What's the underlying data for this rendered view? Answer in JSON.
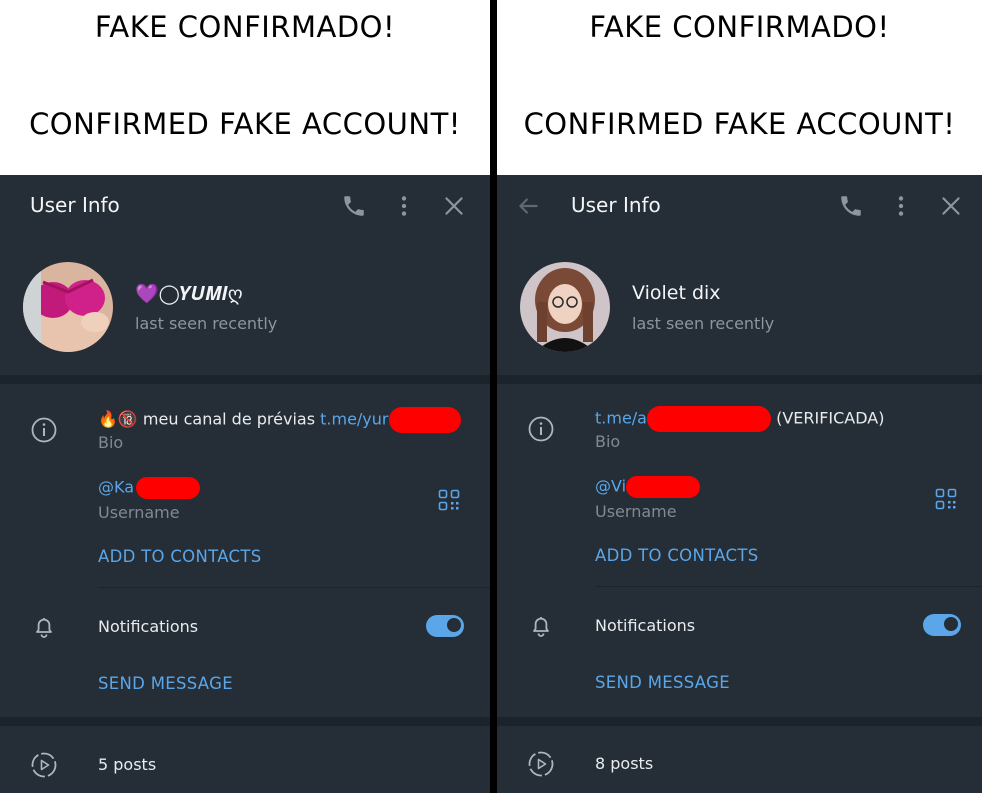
{
  "panels": [
    {
      "banner": {
        "line1": "FAKE CONFIRMADO!",
        "line2": "CONFIRMED FAKE ACCOUNT!"
      },
      "header": {
        "title": "User Info",
        "icons": [
          "phone-icon",
          "more-vertical-icon",
          "close-icon"
        ]
      },
      "profile": {
        "name": "💜◯𝒀𝑼𝑴𝑰ღ",
        "status": "last seen recently"
      },
      "bio": {
        "prefix": "🔥🔞 meu canal de prévias ",
        "link": "t.me/yur",
        "label": "Bio"
      },
      "username": {
        "value": "@Ka",
        "label": "Username"
      },
      "add_contacts": "ADD TO CONTACTS",
      "notifications": {
        "label": "Notifications",
        "enabled": true
      },
      "send_message": "SEND MESSAGE",
      "posts": "5 posts"
    },
    {
      "banner": {
        "line1": "FAKE CONFIRMADO!",
        "line2": "CONFIRMED FAKE ACCOUNT!"
      },
      "header": {
        "title": "User Info",
        "icons": [
          "back-arrow-icon",
          "phone-icon",
          "more-vertical-icon",
          "close-icon"
        ]
      },
      "profile": {
        "name": "Violet dix",
        "status": "last seen recently"
      },
      "bio": {
        "link": "t.me/a",
        "suffix": " (VERIFICADA)",
        "label": "Bio"
      },
      "username": {
        "value": "@Vi",
        "label": "Username"
      },
      "add_contacts": "ADD TO CONTACTS",
      "notifications": {
        "label": "Notifications",
        "enabled": true
      },
      "send_message": "SEND MESSAGE",
      "posts": "8 posts"
    }
  ],
  "colors": {
    "background": "#252d36",
    "separator": "#1c232a",
    "accent": "#5aa6e8",
    "redaction": "#ff0000"
  }
}
